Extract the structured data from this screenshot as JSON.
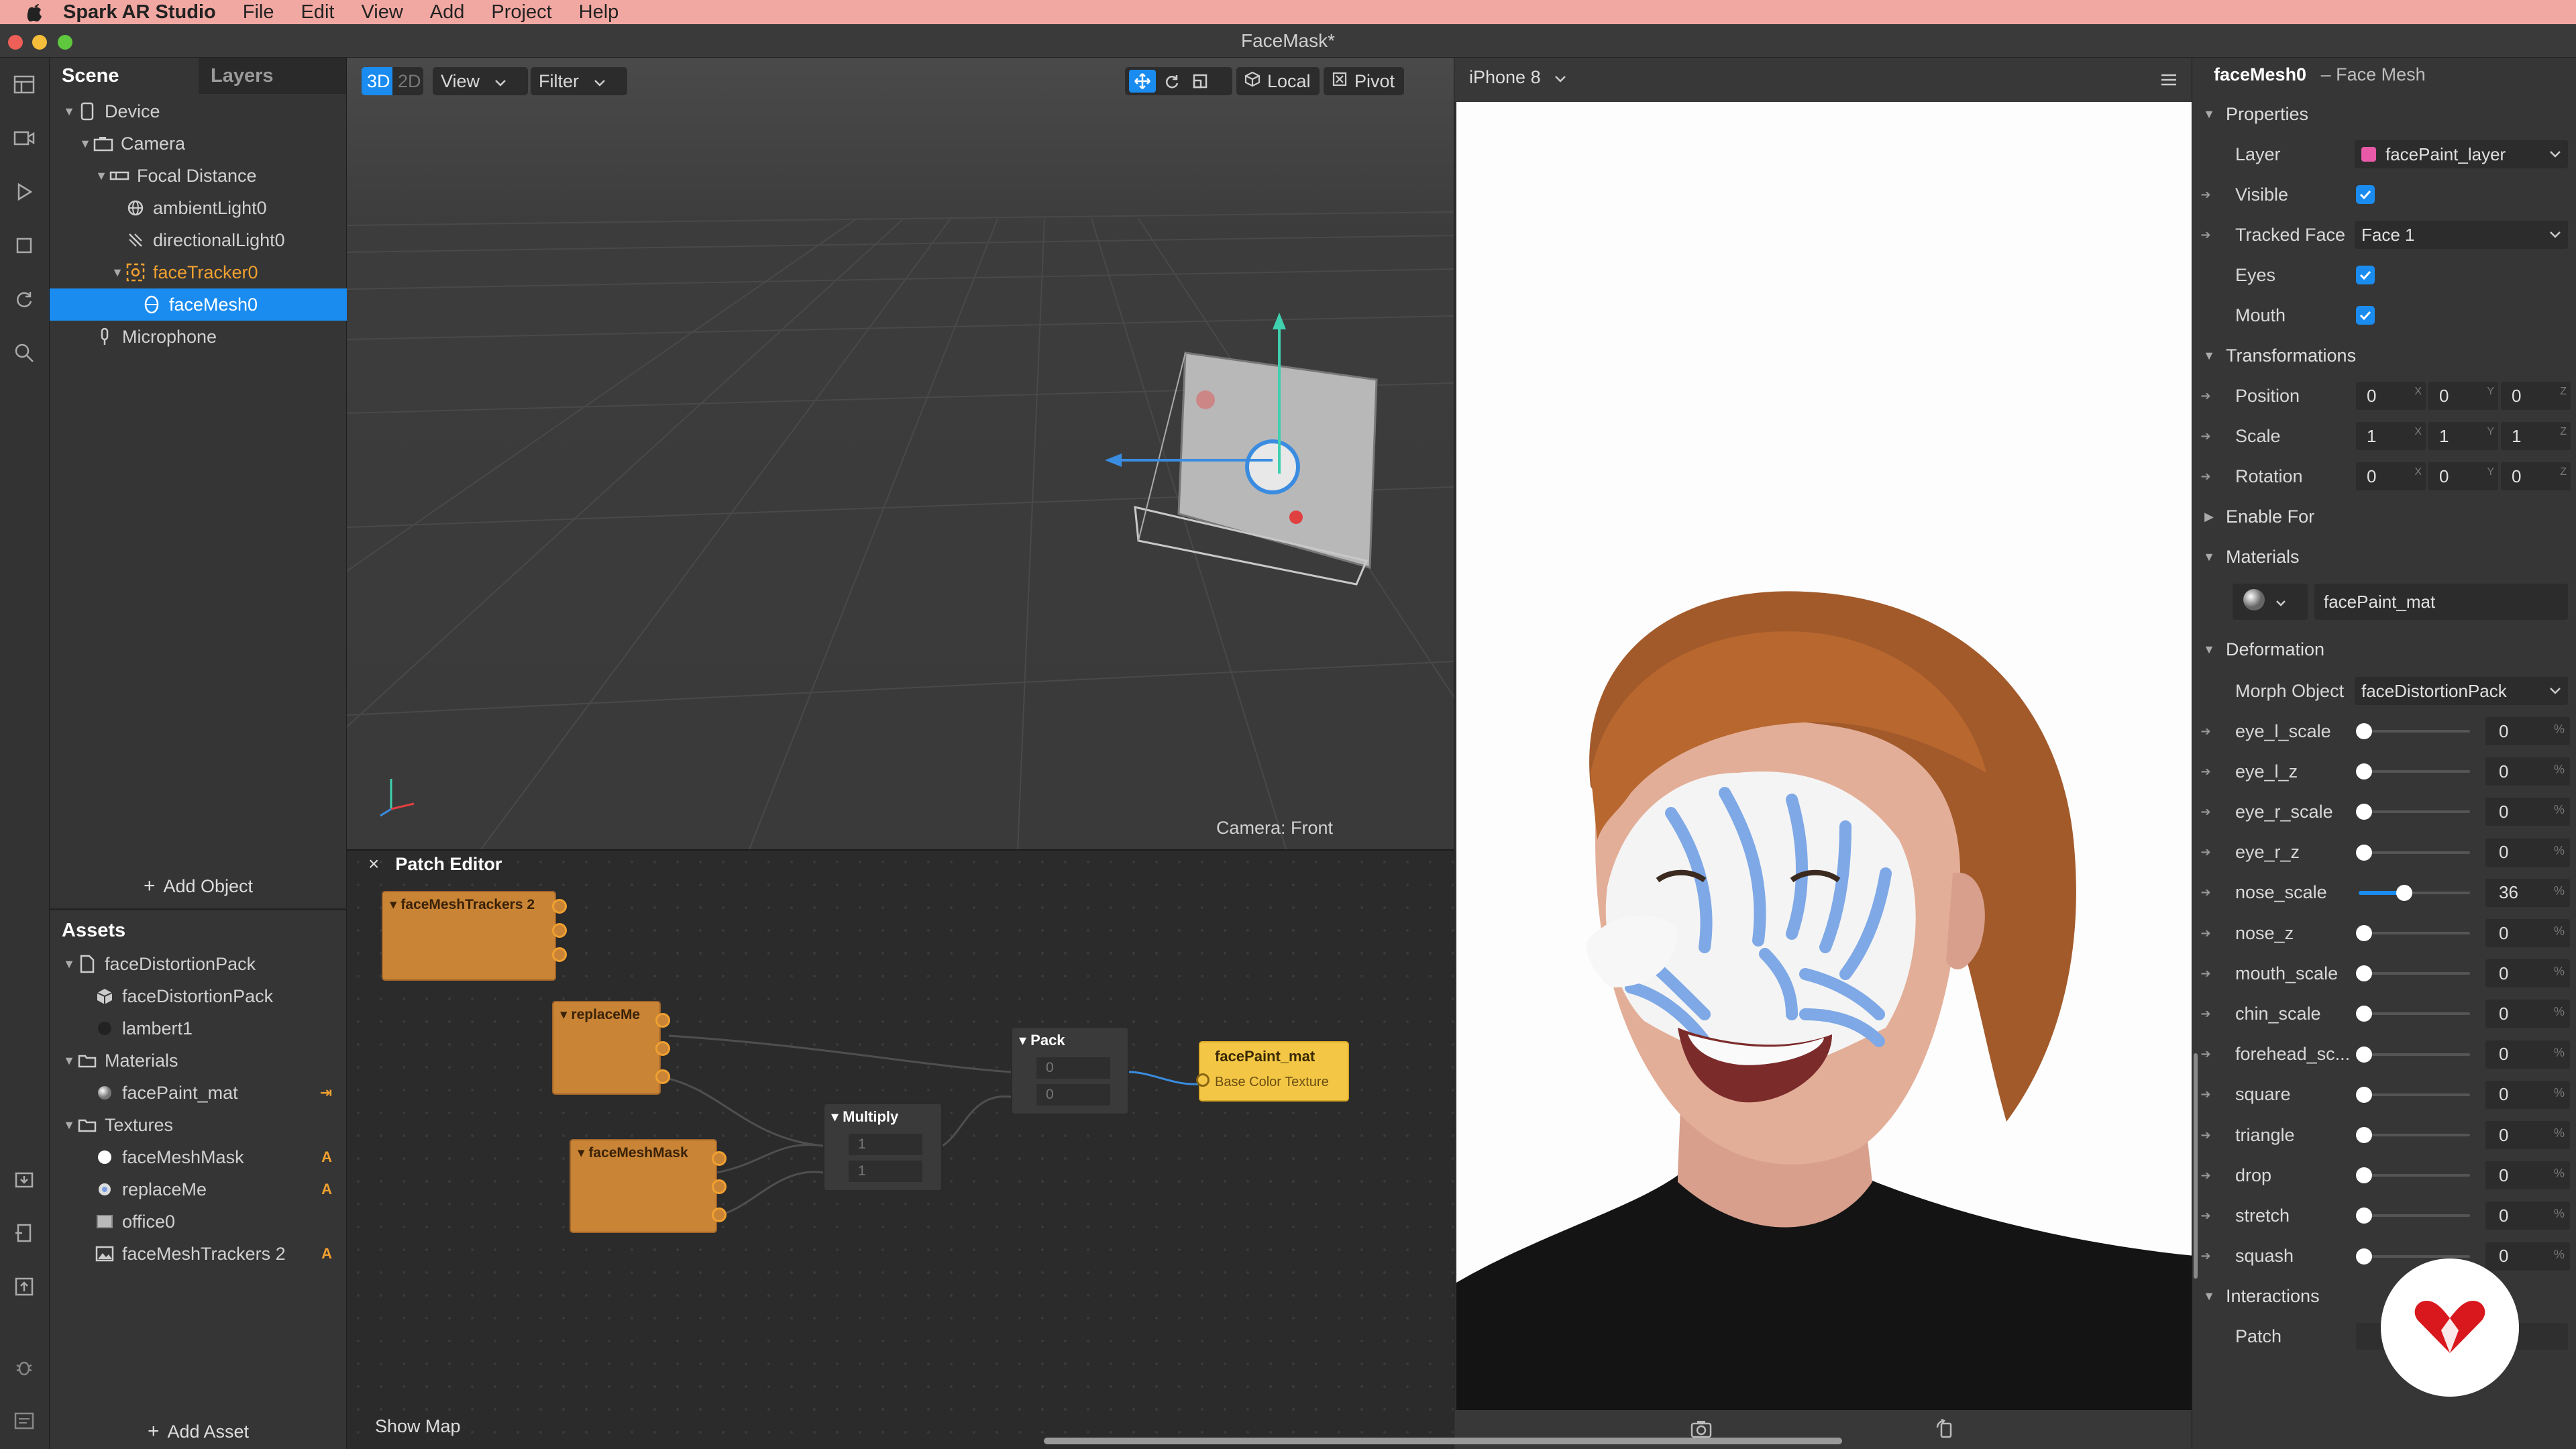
{
  "menubar": {
    "app_name": "Spark AR Studio",
    "items": [
      "File",
      "Edit",
      "View",
      "Add",
      "Project",
      "Help"
    ]
  },
  "window": {
    "title": "FaceMask*"
  },
  "scene_panel": {
    "tabs": [
      "Scene",
      "Layers"
    ],
    "tree": [
      {
        "label": "Device",
        "icon": "device-icon"
      },
      {
        "label": "Camera",
        "icon": "camera-icon"
      },
      {
        "label": "Focal Distance",
        "icon": "focal-distance-icon"
      },
      {
        "label": "ambientLight0",
        "icon": "ambient-light-icon"
      },
      {
        "label": "directionalLight0",
        "icon": "directional-light-icon"
      },
      {
        "label": "faceTracker0",
        "icon": "face-tracker-icon"
      },
      {
        "label": "faceMesh0",
        "icon": "face-mesh-icon"
      },
      {
        "label": "Microphone",
        "icon": "microphone-icon"
      }
    ],
    "add_object": "Add Object"
  },
  "assets_panel": {
    "title": "Assets",
    "items": [
      {
        "label": "faceDistortionPack",
        "badge": ""
      },
      {
        "label": "faceDistortionPack",
        "badge": ""
      },
      {
        "label": "lambert1",
        "badge": ""
      },
      {
        "label": "Materials",
        "badge": ""
      },
      {
        "label": "facePaint_mat",
        "badge": "⇥"
      },
      {
        "label": "Textures",
        "badge": ""
      },
      {
        "label": "faceMeshMask",
        "badge": "A"
      },
      {
        "label": "replaceMe",
        "badge": "A"
      },
      {
        "label": "office0",
        "badge": ""
      },
      {
        "label": "faceMeshTrackers 2",
        "badge": "A"
      }
    ],
    "add_asset": "Add Asset"
  },
  "viewport": {
    "mode_3d": "3D",
    "mode_2d": "2D",
    "view_menu": "View",
    "filter_menu": "Filter",
    "local_label": "Local",
    "pivot_label": "Pivot",
    "camera_label": "Camera: Front"
  },
  "patch_editor": {
    "title": "Patch Editor",
    "close": "×",
    "show_map": "Show Map",
    "nodes": {
      "trackers": "faceMeshTrackers 2",
      "replace": "replaceMe",
      "mask": "faceMeshMask",
      "multiply": "Multiply",
      "multiply_in1": "1",
      "multiply_in2": "1",
      "pack": "Pack",
      "pack_in1": "0",
      "pack_in2": "0",
      "material": "facePaint_mat",
      "material_port": "Base Color Texture"
    }
  },
  "preview": {
    "device": "iPhone 8"
  },
  "inspector": {
    "object_name": "faceMesh0",
    "object_type": "– Face Mesh",
    "properties_header": "Properties",
    "layer_label": "Layer",
    "layer_value": "facePaint_layer",
    "layer_color": "#e85aa8",
    "visible_label": "Visible",
    "tracked_face_label": "Tracked Face",
    "tracked_face_value": "Face 1",
    "eyes_label": "Eyes",
    "mouth_label": "Mouth",
    "transformations_header": "Transformations",
    "position_label": "Position",
    "position": [
      "0",
      "0",
      "0"
    ],
    "scale_label": "Scale",
    "scale": [
      "1",
      "1",
      "1"
    ],
    "rotation_label": "Rotation",
    "rotation": [
      "0",
      "0",
      "0"
    ],
    "axes": [
      "X",
      "Y",
      "Z"
    ],
    "enable_for_header": "Enable For",
    "materials_header": "Materials",
    "material_value": "facePaint_mat",
    "deformation_header": "Deformation",
    "morph_object_label": "Morph Object",
    "morph_object_value": "faceDistortionPack",
    "percent_sign": "%",
    "sliders": [
      {
        "label": "eye_l_scale",
        "value": "0",
        "fraction": 0
      },
      {
        "label": "eye_l_z",
        "value": "0",
        "fraction": 0
      },
      {
        "label": "eye_r_scale",
        "value": "0",
        "fraction": 0
      },
      {
        "label": "eye_r_z",
        "value": "0",
        "fraction": 0
      },
      {
        "label": "nose_scale",
        "value": "36",
        "fraction": 0.36
      },
      {
        "label": "nose_z",
        "value": "0",
        "fraction": 0
      },
      {
        "label": "mouth_scale",
        "value": "0",
        "fraction": 0
      },
      {
        "label": "chin_scale",
        "value": "0",
        "fraction": 0
      },
      {
        "label": "forehead_sc...",
        "value": "0",
        "fraction": 0
      },
      {
        "label": "square",
        "value": "0",
        "fraction": 0
      },
      {
        "label": "triangle",
        "value": "0",
        "fraction": 0
      },
      {
        "label": "drop",
        "value": "0",
        "fraction": 0
      },
      {
        "label": "stretch",
        "value": "0",
        "fraction": 0
      },
      {
        "label": "squash",
        "value": "0",
        "fraction": 0
      }
    ],
    "interactions_header": "Interactions",
    "patch_label": "Patch"
  },
  "colors": {
    "accent": "#1a8cf0",
    "patch_node": "#c98436",
    "material_node": "#f3c745",
    "face_tracker": "#f0a030"
  }
}
